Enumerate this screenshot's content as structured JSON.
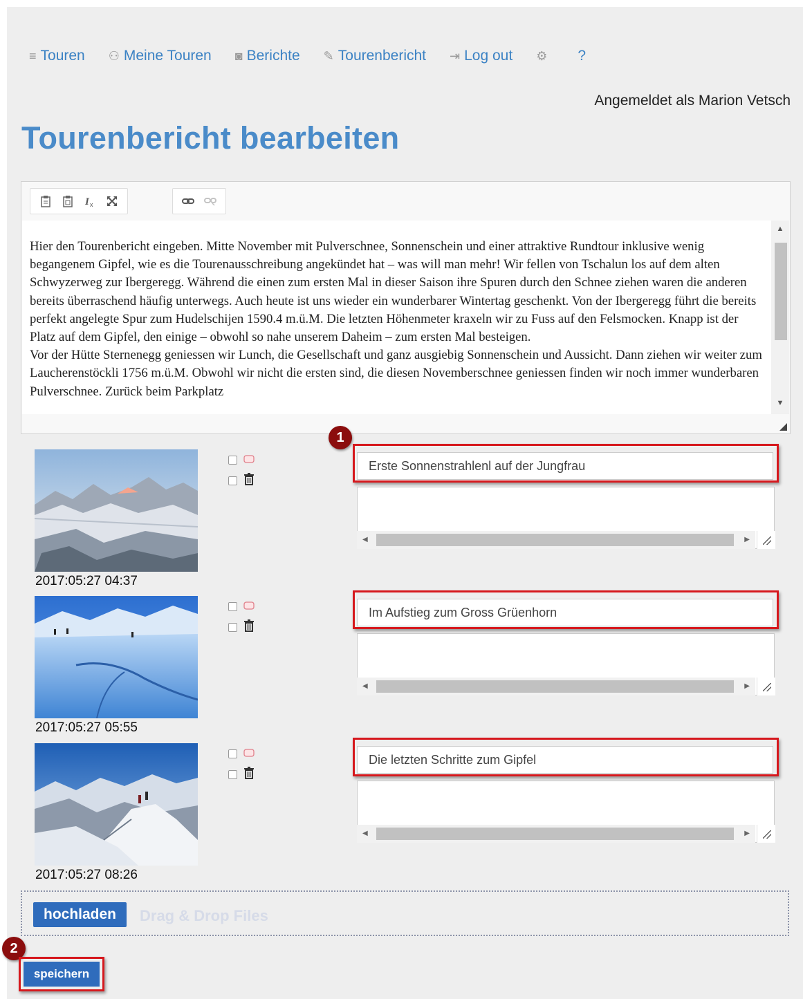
{
  "nav": {
    "items": [
      {
        "label": "Touren",
        "icon": "list-icon",
        "glyph": "≡"
      },
      {
        "label": "Meine Touren",
        "icon": "hikers-icon",
        "glyph": "⚇"
      },
      {
        "label": "Berichte",
        "icon": "camera-icon",
        "glyph": "◙"
      },
      {
        "label": "Tourenbericht",
        "icon": "pencil-icon",
        "glyph": "✎"
      },
      {
        "label": "Log out",
        "icon": "logout-icon",
        "glyph": "⇥"
      }
    ],
    "settings_glyph": "⚙",
    "help_label": "?"
  },
  "user_status": "Angemeldet als Marion Vetsch",
  "page_title": "Tourenbericht bearbeiten",
  "editor": {
    "toolbar": [
      {
        "name": "paste-icon",
        "glyph": "📋"
      },
      {
        "name": "paste-word-icon",
        "glyph": "🗐"
      },
      {
        "name": "remove-format-icon",
        "glyph": "Ix"
      },
      {
        "name": "maximize-icon",
        "glyph": "⤢"
      },
      {
        "name": "link-icon",
        "glyph": "🔗"
      },
      {
        "name": "unlink-icon",
        "glyph": "⛓"
      }
    ],
    "paragraphs": [
      "Hier den Tourenbericht eingeben. Mitte November mit Pulverschnee, Sonnenschein und einer attraktive Rundtour inklusive wenig begangenem Gipfel, wie es die Tourenausschreibung angekündet hat – was will man mehr! Wir fellen von Tschalun los auf dem alten Schwyzerweg zur Ibergeregg. Während die einen zum ersten Mal in dieser Saison ihre Spuren durch den Schnee ziehen waren die anderen bereits überraschend häufig unterwegs. Auch heute ist uns wieder ein wunderbarer Wintertag geschenkt. Von der Ibergeregg führt die bereits perfekt angelegte Spur zum Hudelschijen 1590.4 m.ü.M. Die letzten Höhenmeter kraxeln wir zu Fuss auf den Felsmocken. Knapp ist der Platz auf dem Gipfel, den einige – obwohl so nahe unserem Daheim – zum ersten Mal besteigen.",
      "Vor der Hütte Sternenegg geniessen wir Lunch, die Gesellschaft und ganz ausgiebig Sonnenschein und Aussicht. Dann ziehen wir weiter zum Laucherenstöckli 1756 m.ü.M. Obwohl wir nicht die ersten sind, die diesen Novemberschnee geniessen finden wir noch immer wunderbaren Pulverschnee. Zurück beim Parkplatz"
    ]
  },
  "photos": [
    {
      "timestamp": "2017:05:27 04:37",
      "caption": "Erste Sonnenstrahlenl auf der Jungfrau",
      "star_icon": "▭",
      "trash_icon": "🗑"
    },
    {
      "timestamp": "2017:05:27 05:55",
      "caption": "Im Aufstieg zum Gross Grüenhorn",
      "star_icon": "▭",
      "trash_icon": "🗑"
    },
    {
      "timestamp": "2017:05:27 08:26",
      "caption": "Die letzten Schritte zum Gipfel",
      "star_icon": "▭",
      "trash_icon": "🗑"
    }
  ],
  "markers": [
    "1",
    "2"
  ],
  "upload": {
    "button_label": "hochladen",
    "drop_label": "Drag & Drop Files"
  },
  "save_label": "speichern",
  "colors": {
    "link_blue": "#3b82c4",
    "title_blue": "#4a8bc9",
    "button_blue": "#2f6cbc",
    "highlight_red": "#d6181d",
    "marker_red": "#8b0d0d"
  }
}
